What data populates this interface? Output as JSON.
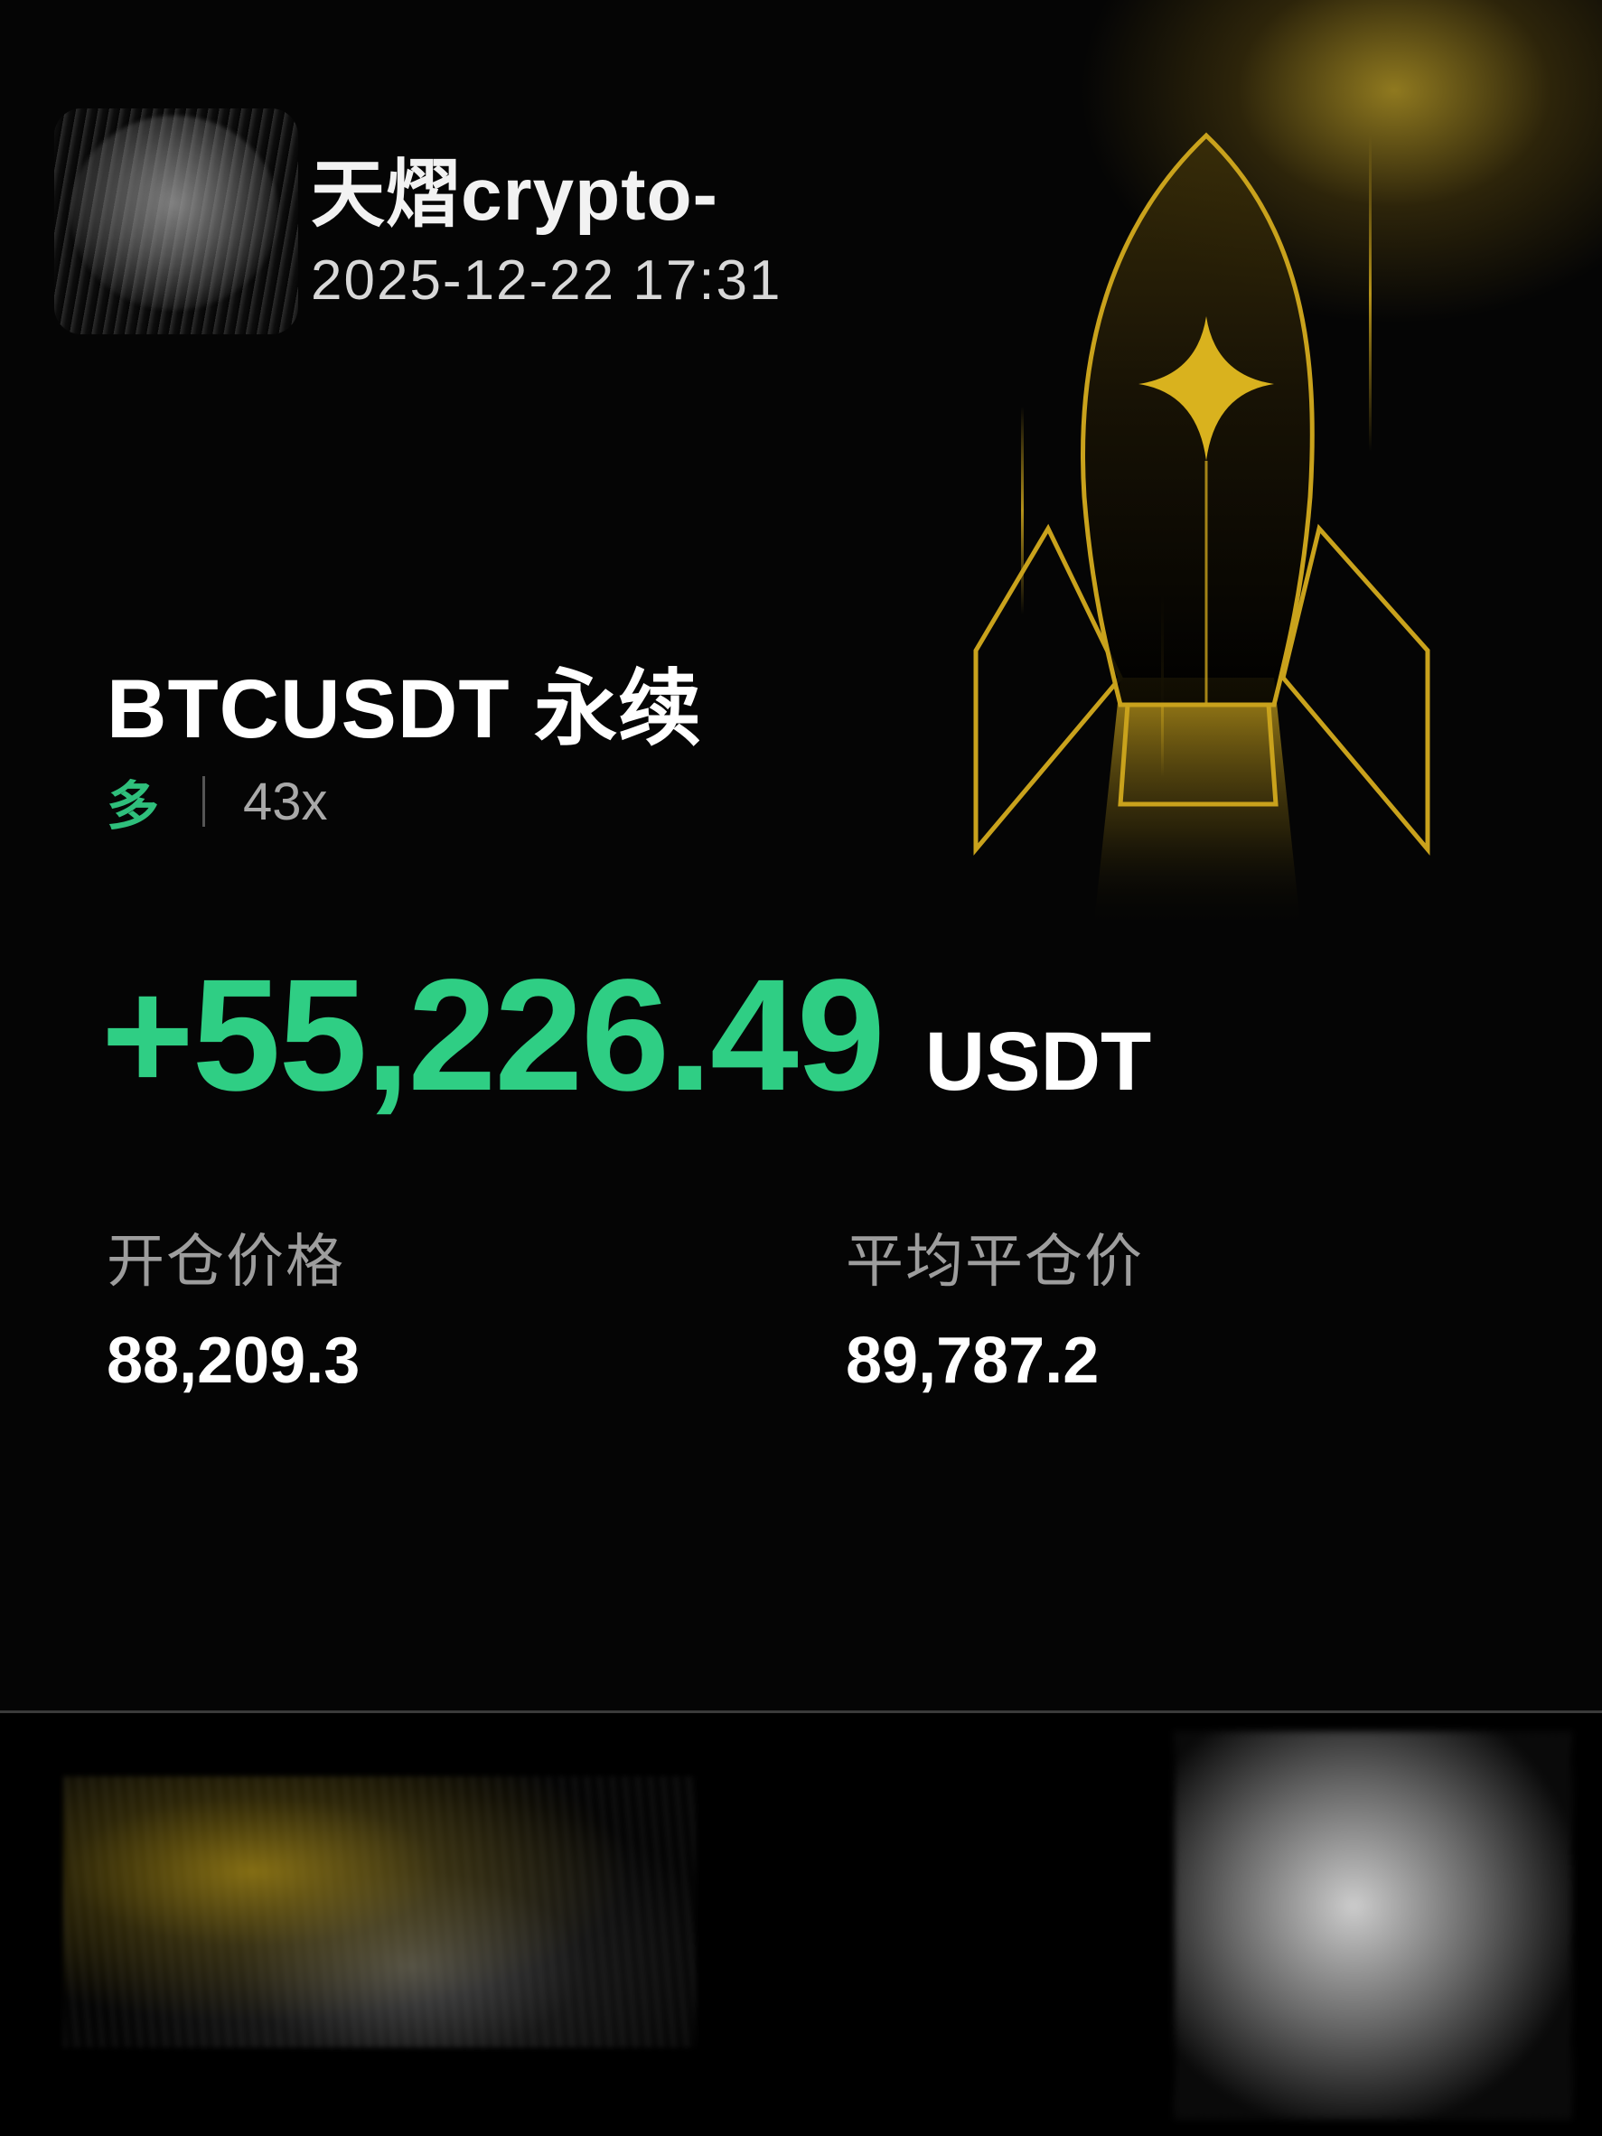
{
  "header": {
    "username": "天熠crypto-",
    "timestamp": "2025-12-22 17:31"
  },
  "position": {
    "pair": "BTCUSDT 永续",
    "side": "多",
    "leverage": "43x"
  },
  "pnl": {
    "value": "+55,226.49",
    "unit": "USDT"
  },
  "stats": {
    "entry_label": "开仓价格",
    "entry_value": "88,209.3",
    "exit_label": "平均平仓价",
    "exit_value": "89,787.2"
  },
  "colors": {
    "profit_green": "#2fce84",
    "long_green": "#2fbf7c",
    "gold": "#c9a21c",
    "background": "#050505"
  },
  "icons": {
    "avatar": "avatar-image",
    "rocket": "rocket-icon"
  }
}
